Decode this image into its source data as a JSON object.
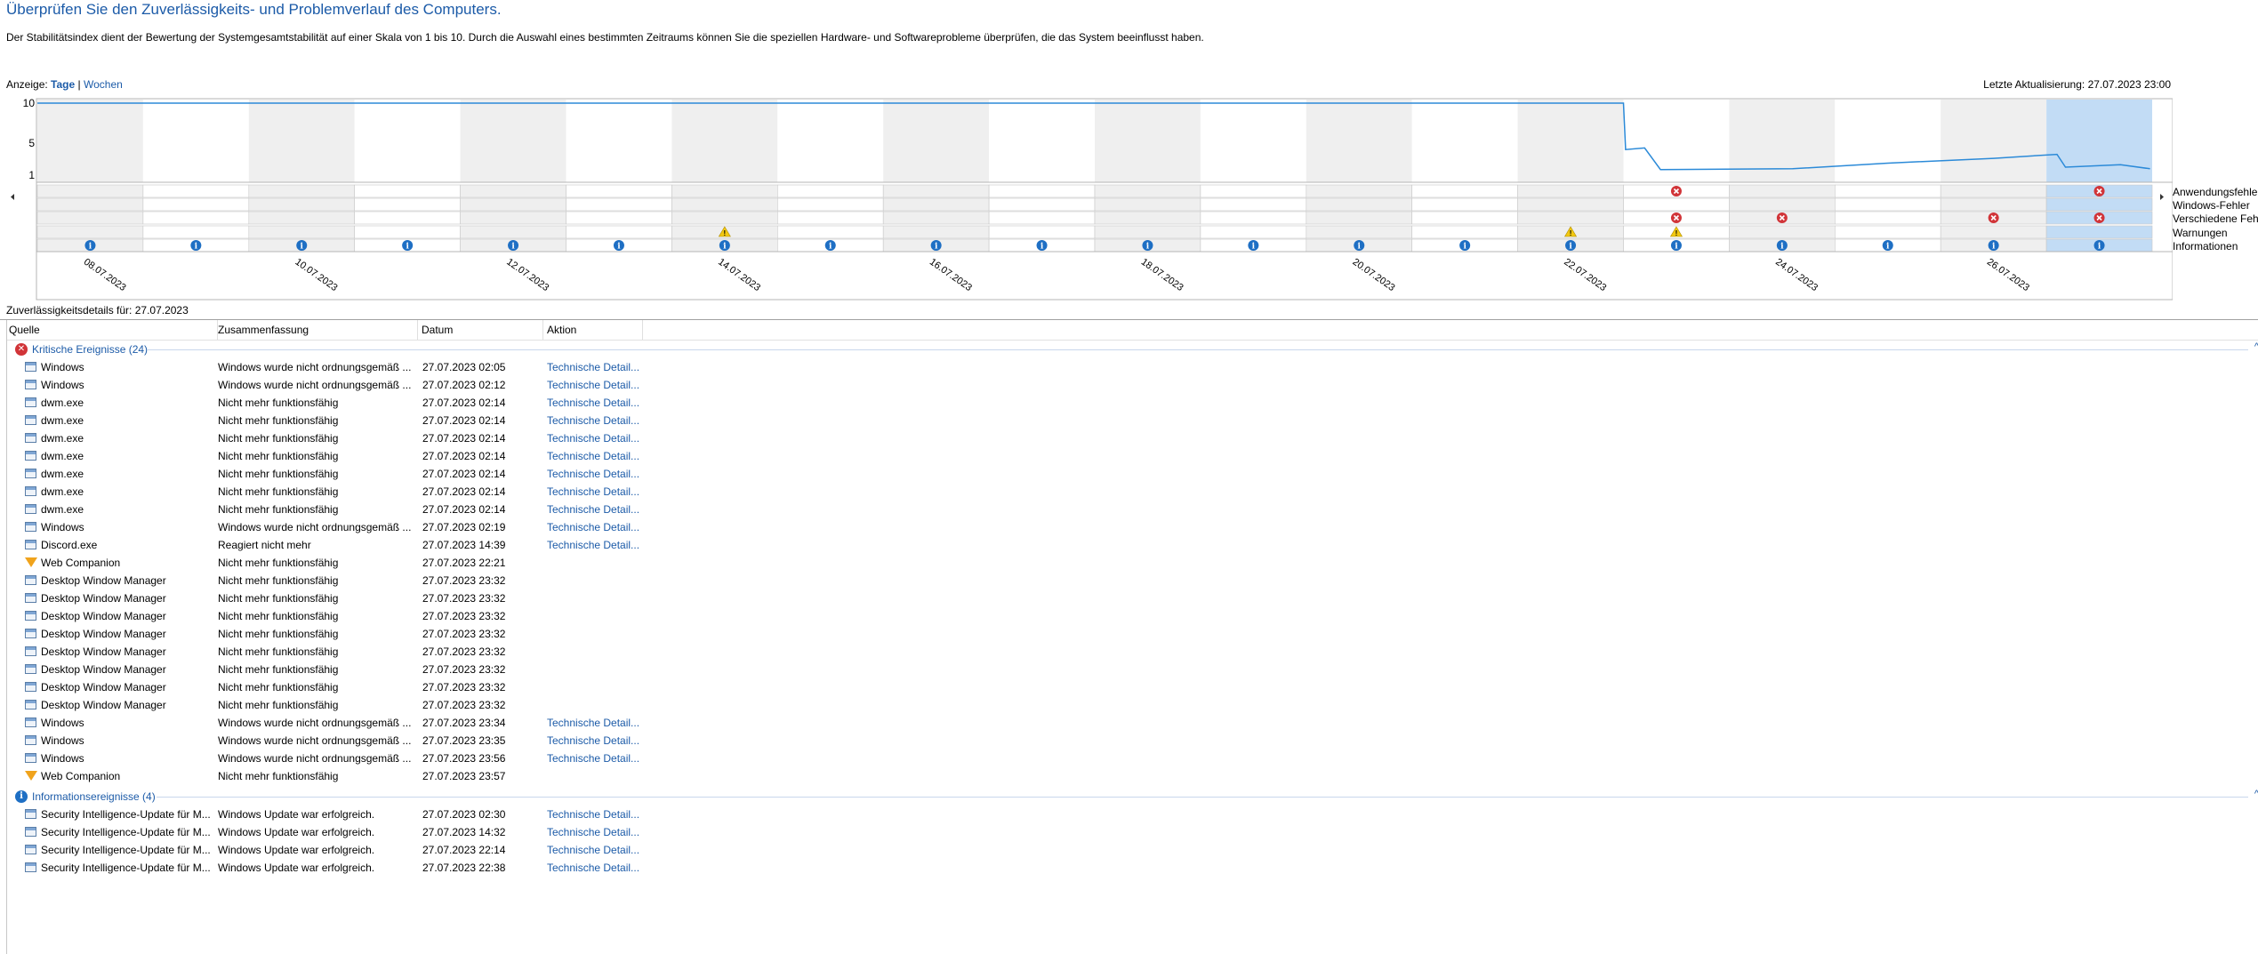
{
  "page": {
    "title": "Überprüfen Sie den Zuverlässigkeits- und Problemverlauf des Computers.",
    "description": "Der Stabilitätsindex dient der Bewertung der Systemgesamtstabilität auf einer Skala von 1 bis 10. Durch die Auswahl eines bestimmten Zeitraums können Sie die speziellen Hardware- und Softwareprobleme überprüfen, die das System beeinflusst haben.",
    "view_label": "Anzeige:",
    "view_days": "Tage",
    "view_separator": "|",
    "view_weeks": "Wochen",
    "last_update": "Letzte Aktualisierung: 27.07.2023 23:00",
    "details_label": "Zuverlässigkeitsdetails für: 27.07.2023"
  },
  "chart_data": {
    "type": "line",
    "title": "",
    "y_ticks": [
      "10",
      "5",
      "1"
    ],
    "ylim": [
      1,
      10
    ],
    "x_dates": [
      "08.07.2023",
      "09.07.2023",
      "10.07.2023",
      "11.07.2023",
      "12.07.2023",
      "13.07.2023",
      "14.07.2023",
      "15.07.2023",
      "16.07.2023",
      "17.07.2023",
      "18.07.2023",
      "19.07.2023",
      "20.07.2023",
      "21.07.2023",
      "22.07.2023",
      "23.07.2023",
      "24.07.2023",
      "25.07.2023",
      "26.07.2023",
      "27.07.2023"
    ],
    "tick_labels": [
      "08.07.2023",
      "10.07.2023",
      "12.07.2023",
      "14.07.2023",
      "16.07.2023",
      "18.07.2023",
      "20.07.2023",
      "22.07.2023",
      "24.07.2023",
      "26.07.2023"
    ],
    "selected_date": "27.07.2023",
    "stability_index": [
      {
        "x": "08.07.2023",
        "y": 10
      },
      {
        "x": "22.07.2023",
        "y": 10
      },
      {
        "x": "23.07.2023",
        "y": 10
      },
      {
        "x": "23.07.2023",
        "y": 4.2
      },
      {
        "x": "23.07.2023",
        "y": 4.4
      },
      {
        "x": "23.07.2023",
        "y": 1.7
      },
      {
        "x": "24.07.2023",
        "y": 1.8
      },
      {
        "x": "25.07.2023",
        "y": 2.5
      },
      {
        "x": "26.07.2023",
        "y": 3.1
      },
      {
        "x": "27.07.2023",
        "y": 3.6
      },
      {
        "x": "27.07.2023",
        "y": 2.0
      },
      {
        "x": "27.07.2023",
        "y": 2.3
      },
      {
        "x": "27.07.2023",
        "y": 1.8
      }
    ],
    "rows": [
      "Anwendungsfehler",
      "Windows-Fehler",
      "Verschiedene Fehler",
      "Warnungen",
      "Informationen"
    ],
    "legend": [
      "Anwendungsfehler",
      "Windows-Fehler",
      "Verschiedene Fehler",
      "Warnungen",
      "Informationen"
    ],
    "events": [
      {
        "date": "23.07.2023",
        "row": "Anwendungsfehler",
        "kind": "error"
      },
      {
        "date": "27.07.2023",
        "row": "Anwendungsfehler",
        "kind": "error"
      },
      {
        "date": "23.07.2023",
        "row": "Verschiedene Fehler",
        "kind": "error"
      },
      {
        "date": "24.07.2023",
        "row": "Verschiedene Fehler",
        "kind": "error"
      },
      {
        "date": "26.07.2023",
        "row": "Verschiedene Fehler",
        "kind": "error"
      },
      {
        "date": "27.07.2023",
        "row": "Verschiedene Fehler",
        "kind": "error"
      },
      {
        "date": "14.07.2023",
        "row": "Warnungen",
        "kind": "warning"
      },
      {
        "date": "22.07.2023",
        "row": "Warnungen",
        "kind": "warning"
      },
      {
        "date": "23.07.2023",
        "row": "Warnungen",
        "kind": "warning"
      }
    ],
    "info_dates": [
      "08.07.2023",
      "09.07.2023",
      "10.07.2023",
      "11.07.2023",
      "12.07.2023",
      "13.07.2023",
      "14.07.2023",
      "15.07.2023",
      "16.07.2023",
      "17.07.2023",
      "18.07.2023",
      "19.07.2023",
      "20.07.2023",
      "21.07.2023",
      "22.07.2023",
      "23.07.2023",
      "24.07.2023",
      "25.07.2023",
      "26.07.2023",
      "27.07.2023"
    ]
  },
  "table": {
    "columns": [
      "Quelle",
      "Zusammenfassung",
      "Datum",
      "Aktion"
    ],
    "sort_indicator": "^",
    "collapse_icon": "^",
    "groups": [
      {
        "label": "Kritische Ereignisse (24)",
        "icon": "critical-error-icon",
        "rows": [
          {
            "icon": "app",
            "source": "Windows",
            "summary": "Windows wurde nicht ordnungsgemäß ...",
            "date": "27.07.2023 02:05",
            "action": "Technische Detail..."
          },
          {
            "icon": "app",
            "source": "Windows",
            "summary": "Windows wurde nicht ordnungsgemäß ...",
            "date": "27.07.2023 02:12",
            "action": "Technische Detail..."
          },
          {
            "icon": "app",
            "source": "dwm.exe",
            "summary": "Nicht mehr funktionsfähig",
            "date": "27.07.2023 02:14",
            "action": "Technische Detail..."
          },
          {
            "icon": "app",
            "source": "dwm.exe",
            "summary": "Nicht mehr funktionsfähig",
            "date": "27.07.2023 02:14",
            "action": "Technische Detail..."
          },
          {
            "icon": "app",
            "source": "dwm.exe",
            "summary": "Nicht mehr funktionsfähig",
            "date": "27.07.2023 02:14",
            "action": "Technische Detail..."
          },
          {
            "icon": "app",
            "source": "dwm.exe",
            "summary": "Nicht mehr funktionsfähig",
            "date": "27.07.2023 02:14",
            "action": "Technische Detail..."
          },
          {
            "icon": "app",
            "source": "dwm.exe",
            "summary": "Nicht mehr funktionsfähig",
            "date": "27.07.2023 02:14",
            "action": "Technische Detail..."
          },
          {
            "icon": "app",
            "source": "dwm.exe",
            "summary": "Nicht mehr funktionsfähig",
            "date": "27.07.2023 02:14",
            "action": "Technische Detail..."
          },
          {
            "icon": "app",
            "source": "dwm.exe",
            "summary": "Nicht mehr funktionsfähig",
            "date": "27.07.2023 02:14",
            "action": "Technische Detail..."
          },
          {
            "icon": "app",
            "source": "Windows",
            "summary": "Windows wurde nicht ordnungsgemäß ...",
            "date": "27.07.2023 02:19",
            "action": "Technische Detail..."
          },
          {
            "icon": "app",
            "source": "Discord.exe",
            "summary": "Reagiert nicht mehr",
            "date": "27.07.2023 14:39",
            "action": "Technische Detail..."
          },
          {
            "icon": "web",
            "source": "Web Companion",
            "summary": "Nicht mehr funktionsfähig",
            "date": "27.07.2023 22:21",
            "action": ""
          },
          {
            "icon": "app",
            "source": "Desktop Window Manager",
            "summary": "Nicht mehr funktionsfähig",
            "date": "27.07.2023 23:32",
            "action": ""
          },
          {
            "icon": "app",
            "source": "Desktop Window Manager",
            "summary": "Nicht mehr funktionsfähig",
            "date": "27.07.2023 23:32",
            "action": ""
          },
          {
            "icon": "app",
            "source": "Desktop Window Manager",
            "summary": "Nicht mehr funktionsfähig",
            "date": "27.07.2023 23:32",
            "action": ""
          },
          {
            "icon": "app",
            "source": "Desktop Window Manager",
            "summary": "Nicht mehr funktionsfähig",
            "date": "27.07.2023 23:32",
            "action": ""
          },
          {
            "icon": "app",
            "source": "Desktop Window Manager",
            "summary": "Nicht mehr funktionsfähig",
            "date": "27.07.2023 23:32",
            "action": ""
          },
          {
            "icon": "app",
            "source": "Desktop Window Manager",
            "summary": "Nicht mehr funktionsfähig",
            "date": "27.07.2023 23:32",
            "action": ""
          },
          {
            "icon": "app",
            "source": "Desktop Window Manager",
            "summary": "Nicht mehr funktionsfähig",
            "date": "27.07.2023 23:32",
            "action": ""
          },
          {
            "icon": "app",
            "source": "Desktop Window Manager",
            "summary": "Nicht mehr funktionsfähig",
            "date": "27.07.2023 23:32",
            "action": ""
          },
          {
            "icon": "app",
            "source": "Windows",
            "summary": "Windows wurde nicht ordnungsgemäß ...",
            "date": "27.07.2023 23:34",
            "action": "Technische Detail..."
          },
          {
            "icon": "app",
            "source": "Windows",
            "summary": "Windows wurde nicht ordnungsgemäß ...",
            "date": "27.07.2023 23:35",
            "action": "Technische Detail..."
          },
          {
            "icon": "app",
            "source": "Windows",
            "summary": "Windows wurde nicht ordnungsgemäß ...",
            "date": "27.07.2023 23:56",
            "action": "Technische Detail..."
          },
          {
            "icon": "web",
            "source": "Web Companion",
            "summary": "Nicht mehr funktionsfähig",
            "date": "27.07.2023 23:57",
            "action": ""
          }
        ]
      },
      {
        "label": "Informationsereignisse (4)",
        "icon": "information-icon",
        "rows": [
          {
            "icon": "app",
            "source": "Security Intelligence-Update für M...",
            "summary": "Windows Update war erfolgreich.",
            "date": "27.07.2023 02:30",
            "action": "Technische Detail..."
          },
          {
            "icon": "app",
            "source": "Security Intelligence-Update für M...",
            "summary": "Windows Update war erfolgreich.",
            "date": "27.07.2023 14:32",
            "action": "Technische Detail..."
          },
          {
            "icon": "app",
            "source": "Security Intelligence-Update für M...",
            "summary": "Windows Update war erfolgreich.",
            "date": "27.07.2023 22:14",
            "action": "Technische Detail..."
          },
          {
            "icon": "app",
            "source": "Security Intelligence-Update für M...",
            "summary": "Windows Update war erfolgreich.",
            "date": "27.07.2023 22:38",
            "action": "Technische Detail..."
          }
        ]
      }
    ]
  },
  "colors": {
    "accent": "#1c5ba8",
    "line": "#2b8ad8",
    "selected_column": "#c2dcf5",
    "shaded_column": "#efefef",
    "error": "#d13438",
    "warning": "#f2c811",
    "info": "#1e6fc4"
  }
}
